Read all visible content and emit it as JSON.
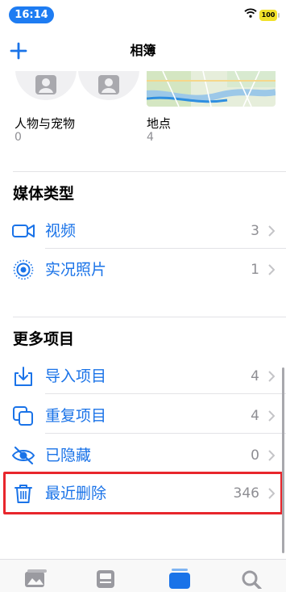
{
  "status_bar": {
    "time": "16:14",
    "battery": "100"
  },
  "nav": {
    "title": "相簿",
    "add_icon": "plus-icon"
  },
  "people_places": {
    "people": {
      "title": "人物与宠物",
      "count": "0"
    },
    "places": {
      "title": "地点",
      "count": "4"
    }
  },
  "media_types": {
    "header": "媒体类型",
    "items": [
      {
        "label": "视频",
        "count": "3",
        "icon": "video-icon"
      },
      {
        "label": "实况照片",
        "count": "1",
        "icon": "live-photo-icon"
      }
    ]
  },
  "utilities": {
    "header": "更多项目",
    "items": [
      {
        "label": "导入项目",
        "count": "4",
        "icon": "import-icon"
      },
      {
        "label": "重复项目",
        "count": "4",
        "icon": "duplicate-icon"
      },
      {
        "label": "已隐藏",
        "count": "0",
        "icon": "hidden-eye-icon"
      },
      {
        "label": "最近删除",
        "count": "346",
        "icon": "trash-icon"
      }
    ]
  },
  "colors": {
    "accent": "#1a73e8",
    "highlight": "#e8262c",
    "time_pill": "#1e7cf2"
  }
}
